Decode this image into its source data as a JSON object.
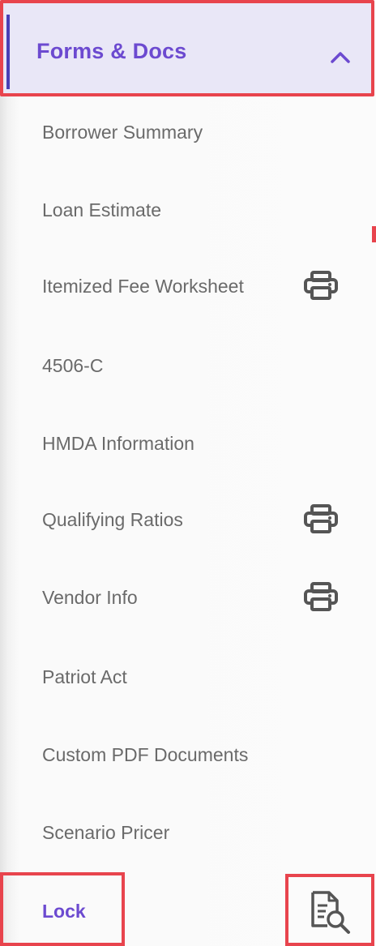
{
  "sidebar": {
    "section": {
      "title": "Forms & Docs",
      "state": "expanded",
      "chevron_icon": "chevron-up-icon"
    },
    "items": [
      {
        "label": "Borrower Summary",
        "print_icon": false
      },
      {
        "label": "Loan Estimate",
        "print_icon": false
      },
      {
        "label": "Itemized Fee Worksheet",
        "print_icon": true
      },
      {
        "label": "4506-C",
        "print_icon": false
      },
      {
        "label": "HMDA Information",
        "print_icon": false
      },
      {
        "label": "Qualifying Ratios",
        "print_icon": true
      },
      {
        "label": "Vendor Info",
        "print_icon": true
      },
      {
        "label": "Patriot Act",
        "print_icon": false
      },
      {
        "label": "Custom PDF Documents",
        "print_icon": false
      },
      {
        "label": "Scenario Pricer",
        "print_icon": false
      }
    ],
    "lock": {
      "label": "Lock",
      "action_icon": "document-search-icon"
    }
  },
  "colors": {
    "accent": "#6c4ad0",
    "header_bg": "#e9e7f7",
    "item_text": "#6a6a6a",
    "icon": "#555555",
    "highlight_border": "#e8444d"
  }
}
